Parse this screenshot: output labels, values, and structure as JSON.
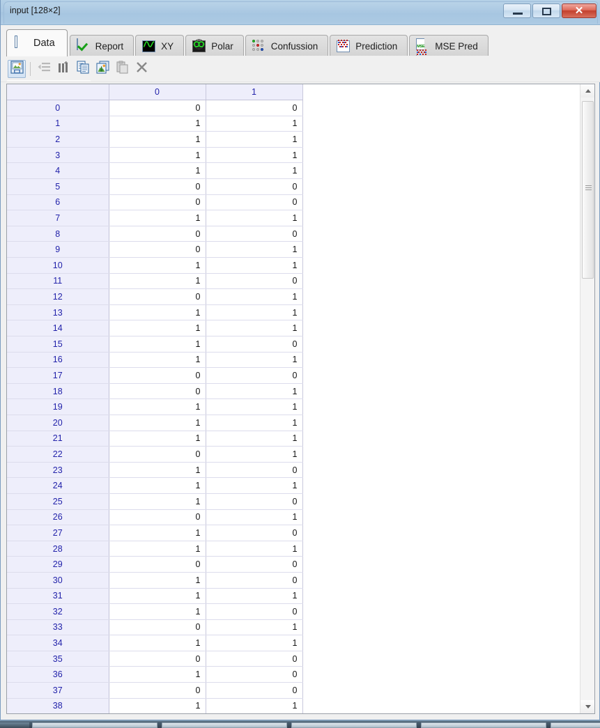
{
  "window": {
    "title": "input [128×2]",
    "buttons": {
      "minimize": "–",
      "maximize": "□",
      "close": "✕"
    }
  },
  "tabs": [
    {
      "id": "data",
      "label": "Data",
      "icon": "table-grid-icon",
      "active": true
    },
    {
      "id": "report",
      "label": "Report",
      "icon": "checkmark-icon",
      "active": false
    },
    {
      "id": "xy",
      "label": "XY",
      "icon": "waveform-icon",
      "active": false
    },
    {
      "id": "polar",
      "label": "Polar",
      "icon": "polar-plot-icon",
      "active": false
    },
    {
      "id": "confussion",
      "label": "Confussion",
      "icon": "dot-matrix-icon",
      "active": false
    },
    {
      "id": "prediction",
      "label": "Prediction",
      "icon": "prediction-grid-icon",
      "active": false
    },
    {
      "id": "msepred",
      "label": "MSE Pred",
      "icon": "mse-grid-icon",
      "active": false
    }
  ],
  "toolbar": [
    {
      "id": "save-image",
      "icon": "save-image-icon",
      "enabled": true,
      "selected": true
    },
    {
      "id": "insert-row",
      "icon": "insert-row-icon",
      "enabled": false,
      "selected": false
    },
    {
      "id": "columns",
      "icon": "insert-column-icon",
      "enabled": true,
      "selected": false
    },
    {
      "id": "copy",
      "icon": "copy-icon",
      "enabled": true,
      "selected": false
    },
    {
      "id": "copy-image",
      "icon": "copy-image-icon",
      "enabled": true,
      "selected": false
    },
    {
      "id": "paste",
      "icon": "paste-icon",
      "enabled": false,
      "selected": false
    },
    {
      "id": "delete",
      "icon": "delete-x-icon",
      "enabled": true,
      "selected": false
    }
  ],
  "grid": {
    "corner_label": "",
    "columns": [
      "0",
      "1"
    ],
    "rows": [
      {
        "index": "0",
        "values": [
          "0",
          "0"
        ]
      },
      {
        "index": "1",
        "values": [
          "1",
          "1"
        ]
      },
      {
        "index": "2",
        "values": [
          "1",
          "1"
        ]
      },
      {
        "index": "3",
        "values": [
          "1",
          "1"
        ]
      },
      {
        "index": "4",
        "values": [
          "1",
          "1"
        ]
      },
      {
        "index": "5",
        "values": [
          "0",
          "0"
        ]
      },
      {
        "index": "6",
        "values": [
          "0",
          "0"
        ]
      },
      {
        "index": "7",
        "values": [
          "1",
          "1"
        ]
      },
      {
        "index": "8",
        "values": [
          "0",
          "0"
        ]
      },
      {
        "index": "9",
        "values": [
          "0",
          "1"
        ]
      },
      {
        "index": "10",
        "values": [
          "1",
          "1"
        ]
      },
      {
        "index": "11",
        "values": [
          "1",
          "0"
        ]
      },
      {
        "index": "12",
        "values": [
          "0",
          "1"
        ]
      },
      {
        "index": "13",
        "values": [
          "1",
          "1"
        ]
      },
      {
        "index": "14",
        "values": [
          "1",
          "1"
        ]
      },
      {
        "index": "15",
        "values": [
          "1",
          "0"
        ]
      },
      {
        "index": "16",
        "values": [
          "1",
          "1"
        ]
      },
      {
        "index": "17",
        "values": [
          "0",
          "0"
        ]
      },
      {
        "index": "18",
        "values": [
          "0",
          "1"
        ]
      },
      {
        "index": "19",
        "values": [
          "1",
          "1"
        ]
      },
      {
        "index": "20",
        "values": [
          "1",
          "1"
        ]
      },
      {
        "index": "21",
        "values": [
          "1",
          "1"
        ]
      },
      {
        "index": "22",
        "values": [
          "0",
          "1"
        ]
      },
      {
        "index": "23",
        "values": [
          "1",
          "0"
        ]
      },
      {
        "index": "24",
        "values": [
          "1",
          "1"
        ]
      },
      {
        "index": "25",
        "values": [
          "1",
          "0"
        ]
      },
      {
        "index": "26",
        "values": [
          "0",
          "1"
        ]
      },
      {
        "index": "27",
        "values": [
          "1",
          "0"
        ]
      },
      {
        "index": "28",
        "values": [
          "1",
          "1"
        ]
      },
      {
        "index": "29",
        "values": [
          "0",
          "0"
        ]
      },
      {
        "index": "30",
        "values": [
          "1",
          "0"
        ]
      },
      {
        "index": "31",
        "values": [
          "1",
          "1"
        ]
      },
      {
        "index": "32",
        "values": [
          "1",
          "0"
        ]
      },
      {
        "index": "33",
        "values": [
          "0",
          "1"
        ]
      },
      {
        "index": "34",
        "values": [
          "1",
          "1"
        ]
      },
      {
        "index": "35",
        "values": [
          "0",
          "0"
        ]
      },
      {
        "index": "36",
        "values": [
          "1",
          "0"
        ]
      },
      {
        "index": "37",
        "values": [
          "0",
          "0"
        ]
      },
      {
        "index": "38",
        "values": [
          "1",
          "1"
        ]
      }
    ]
  },
  "scrollbar": {
    "up_arrow": "▲",
    "down_arrow": "▼"
  },
  "colors": {
    "titlebar": "#a9c7e2",
    "header_text": "#2222aa",
    "header_bg": "#eeeefb",
    "close_button": "#c2402d",
    "accent_green": "#18a018"
  }
}
